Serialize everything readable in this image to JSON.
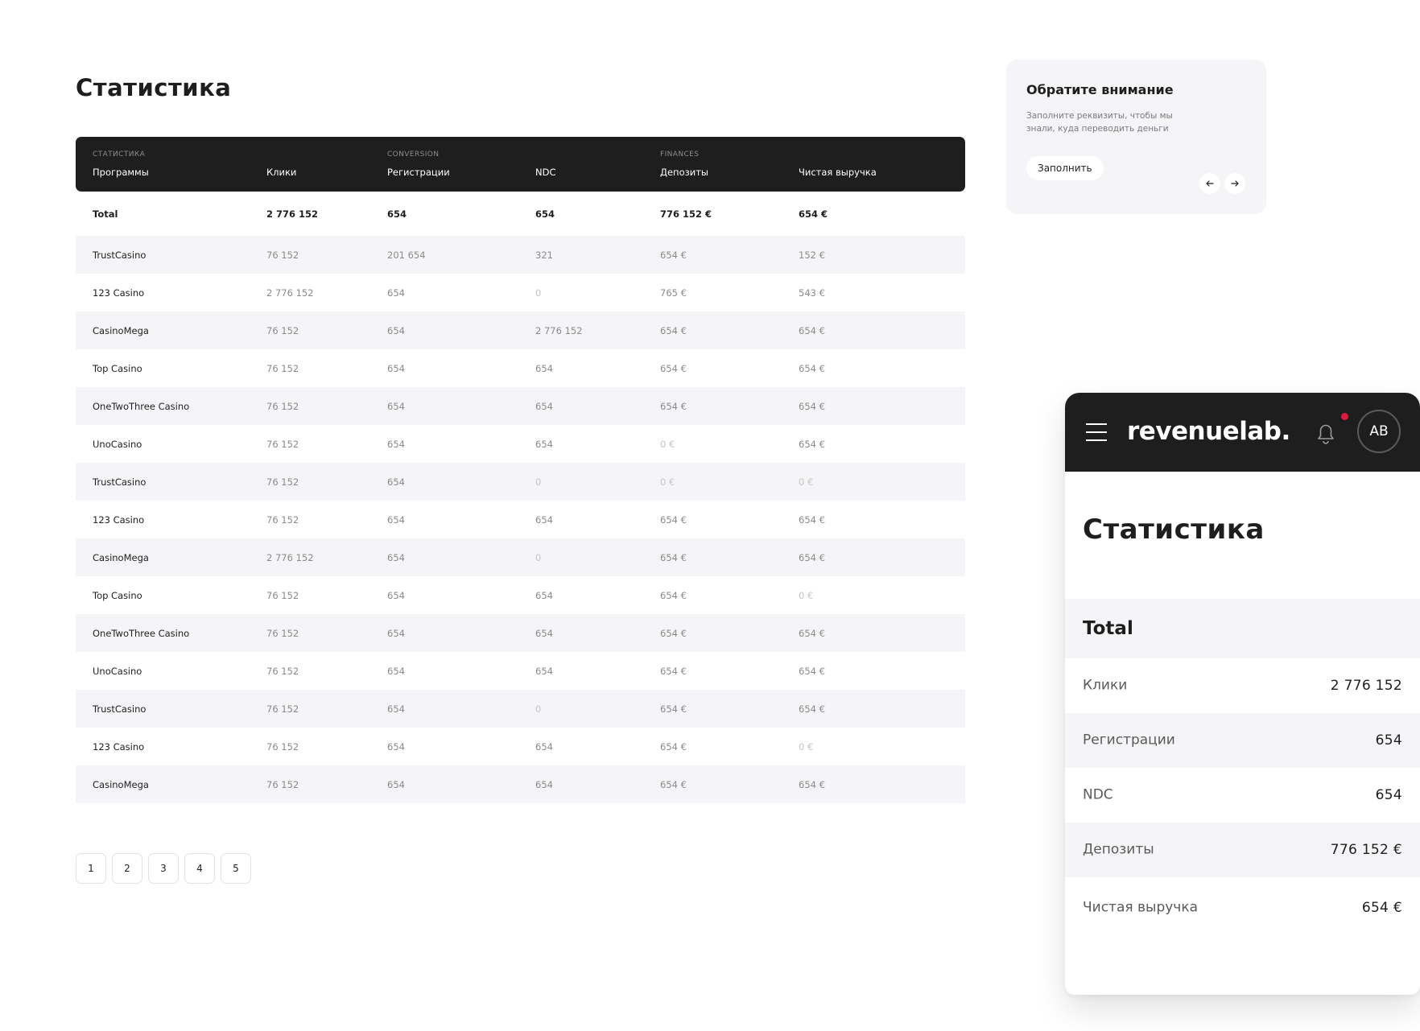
{
  "page": {
    "title": "Статистика"
  },
  "table": {
    "groups": {
      "stats": "СТАТИСТИКА",
      "conversion": "CONVERSION",
      "finances": "FINANCES"
    },
    "columns": [
      "Программы",
      "Клики",
      "Регистрации",
      "NDC",
      "Депозиты",
      "Чистая выручка"
    ],
    "total": [
      "Total",
      "2 776 152",
      "654",
      "654",
      "776 152 €",
      "654 €"
    ],
    "rows": [
      [
        "TrustCasino",
        "76 152",
        "201 654",
        "321",
        "654 €",
        "152 €"
      ],
      [
        "123 Casino",
        "2 776 152",
        "654",
        "0",
        "765 €",
        "543 €"
      ],
      [
        "CasinoMega",
        "76 152",
        "654",
        "2 776 152",
        "654 €",
        "654 €"
      ],
      [
        "Top Casino",
        "76 152",
        "654",
        "654",
        "654 €",
        "654 €"
      ],
      [
        "OneTwoThree Casino",
        "76 152",
        "654",
        "654",
        "654 €",
        "654 €"
      ],
      [
        "UnoCasino",
        "76 152",
        "654",
        "654",
        "0 €",
        "654 €"
      ],
      [
        "TrustCasino",
        "76 152",
        "654",
        "0",
        "0 €",
        "0 €"
      ],
      [
        "123 Casino",
        "76 152",
        "654",
        "654",
        "654 €",
        "654 €"
      ],
      [
        "CasinoMega",
        "2 776 152",
        "654",
        "0",
        "654 €",
        "654 €"
      ],
      [
        "Top Casino",
        "76 152",
        "654",
        "654",
        "654 €",
        "0 €"
      ],
      [
        "OneTwoThree Casino",
        "76 152",
        "654",
        "654",
        "654 €",
        "654 €"
      ],
      [
        "UnoCasino",
        "76 152",
        "654",
        "654",
        "654 €",
        "654 €"
      ],
      [
        "TrustCasino",
        "76 152",
        "654",
        "0",
        "654 €",
        "654 €"
      ],
      [
        "123 Casino",
        "76 152",
        "654",
        "654",
        "654 €",
        "0 €"
      ],
      [
        "CasinoMega",
        "76 152",
        "654",
        "654",
        "654 €",
        "654 €"
      ]
    ]
  },
  "pagination": [
    "1",
    "2",
    "3",
    "4",
    "5"
  ],
  "notice": {
    "title": "Обратите внимание",
    "text": "Заполните реквизиты, чтобы мы знали, куда переводить деньги",
    "button": "Заполнить",
    "prev_icon": "arrow-left-icon",
    "next_icon": "arrow-right-icon"
  },
  "mobile": {
    "logo": "revenuelab.",
    "avatar": "AB",
    "title": "Статистика",
    "total_label": "Total",
    "rows": [
      {
        "label": "Клики",
        "value": "2 776 152"
      },
      {
        "label": "Регистрации",
        "value": "654"
      },
      {
        "label": "NDC",
        "value": "654"
      },
      {
        "label": "Депозиты",
        "value": "776 152 €"
      },
      {
        "label": "Чистая выручка",
        "value": "654 €"
      }
    ]
  },
  "colors": {
    "dark": "#1e1e1e",
    "row_alt": "#f5f5f7",
    "notify_dot": "#e0193f"
  }
}
